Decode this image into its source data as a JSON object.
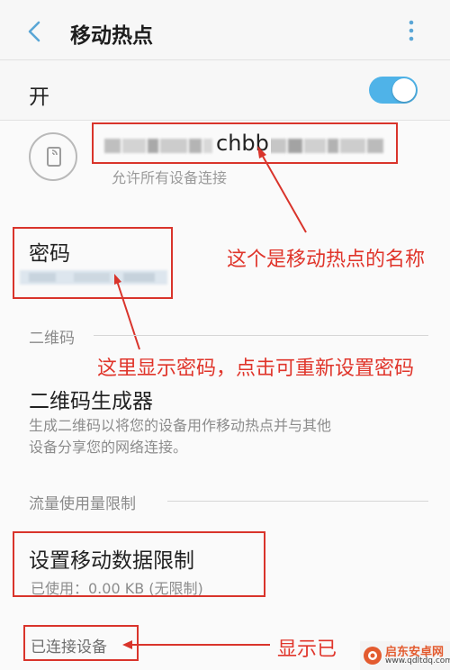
{
  "header": {
    "title": "移动热点",
    "back_icon": "chevron-left-icon",
    "more_icon": "more-vertical-icon"
  },
  "hotspot": {
    "switch_label": "开",
    "switch_on": true,
    "accent": "#4fb3e8"
  },
  "network": {
    "ssid_visible": "chbb",
    "allow_text": "允许所有设备连接",
    "icon": "hotspot-device-icon"
  },
  "password": {
    "label": "密码"
  },
  "qr_section": {
    "header": "二维码",
    "title": "二维码生成器",
    "desc_line1": "生成二维码以将您的设备用作移动热点并与其他",
    "desc_line2": "设备分享您的网络连接。"
  },
  "data_section": {
    "header": "流量使用量限制",
    "title": "设置移动数据限制",
    "usage": "已使用：0.00 KB (无限制)"
  },
  "connected": {
    "header": "已连接设备"
  },
  "annotations": {
    "name_note": "这个是移动热点的名称",
    "password_note": "这里显示密码，点击可重新设置密码",
    "devices_note": "显示已",
    "color": "#d9342b"
  },
  "watermark": {
    "name": "启东安卓网",
    "url": "www.qdltdq.com"
  }
}
